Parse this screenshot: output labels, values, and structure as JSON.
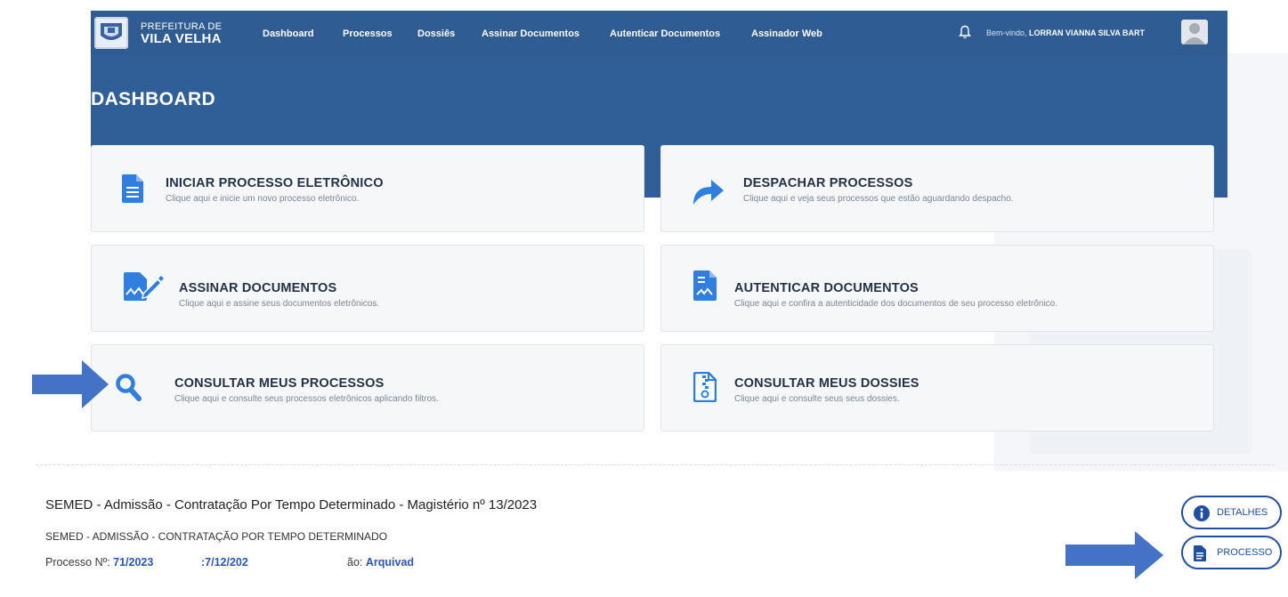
{
  "header": {
    "brand_line1": "PREFEITURA DE",
    "brand_line2": "VILA VELHA",
    "nav": [
      "Dashboard",
      "Processos",
      "Dossiês",
      "Assinar Documentos",
      "Autenticar Documentos",
      "Assinador Web"
    ],
    "welcome": "Bem-vindo,",
    "username": "LORRAN VIANNA SILVA BART"
  },
  "page_title": "DASHBOARD",
  "cards": [
    {
      "title": "INICIAR PROCESSO ELETRÔNICO",
      "subtitle": "Clique aqui e inicie um novo processo eletrônico.",
      "icon": "document-icon"
    },
    {
      "title": "DESPACHAR PROCESSOS",
      "subtitle": "Clique aqui e veja seus processos que estão aguardando despacho.",
      "icon": "share-arrow-icon"
    },
    {
      "title": "ASSINAR DOCUMENTOS",
      "subtitle": "Clique aqui e assine seus documentos eletrônicos.",
      "icon": "signature-icon"
    },
    {
      "title": "AUTENTICAR DOCUMENTOS",
      "subtitle": "Clique aqui e confira a autenticidade dos documentos de seu processo eletrônico.",
      "icon": "certified-document-icon"
    },
    {
      "title": "CONSULTAR MEUS PROCESSOS",
      "subtitle": "Clique aqui e consulte seus processos eletrônicos aplicando filtros.",
      "icon": "search-icon"
    },
    {
      "title": "CONSULTAR MEUS DOSSIES",
      "subtitle": "Clique aqui e consulte seus seus dossies.",
      "icon": "zip-file-icon"
    }
  ],
  "process": {
    "title": "SEMED - Admissão - Contratação Por Tempo Determinado - Magistério nº 13/2023",
    "subtitle": "SEMED - ADMISSÃO - CONTRATAÇÃO POR TEMPO DETERMINADO",
    "number_label": "Processo Nº:",
    "number_value": "71/2023",
    "date_fragment": ":7/12/202",
    "status_label_fragment": "ão:",
    "status_value_fragment": "Arquivad"
  },
  "buttons": {
    "details": "DETALHES",
    "process": "PROCESSO"
  },
  "colors": {
    "header_blue": "#2f5d93",
    "accent_blue": "#2f7ee0",
    "arrow_blue": "#4472c4"
  }
}
